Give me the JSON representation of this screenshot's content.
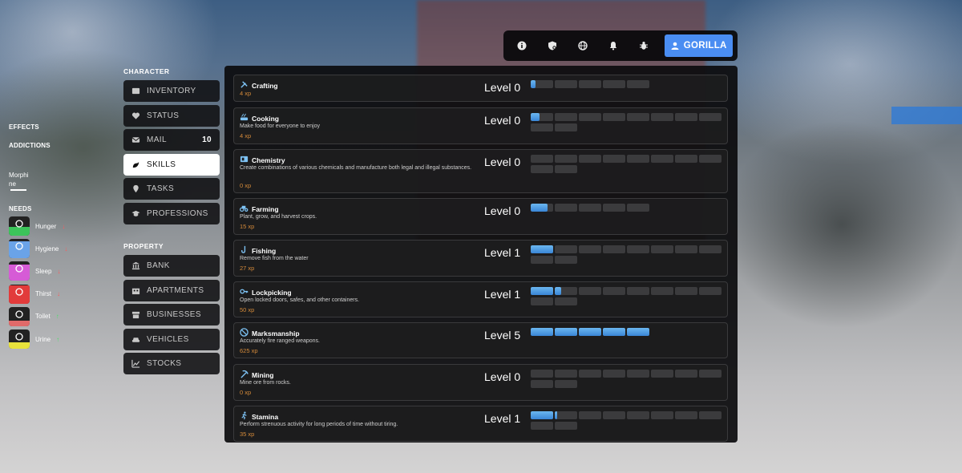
{
  "topbar": {
    "icons": [
      "info-icon",
      "shield-icon",
      "globe-icon",
      "bell-icon",
      "bug-icon"
    ],
    "user_name": "GORILLA",
    "accent": "#4a8df2"
  },
  "hud": {
    "effects_label": "EFFECTS",
    "addictions_label": "ADDICTIONS",
    "addiction_name": "Morphine",
    "needs_label": "NEEDS",
    "needs": [
      {
        "label": "Hunger",
        "trend": "down",
        "fill": 0.45,
        "color": "#3cc45a",
        "icon": "food-icon"
      },
      {
        "label": "Hygiene",
        "trend": "down",
        "fill": 0.9,
        "color": "#6aa3e8",
        "icon": "shower-icon"
      },
      {
        "label": "Sleep",
        "trend": "down",
        "fill": 0.85,
        "color": "#d65bd6",
        "icon": "bed-icon"
      },
      {
        "label": "Thirst",
        "trend": "down",
        "fill": 0.95,
        "color": "#e23b3b",
        "icon": "cup-icon"
      },
      {
        "label": "Toilet",
        "trend": "up",
        "fill": 0.3,
        "color": "#e06a6a",
        "icon": "toilet-icon"
      },
      {
        "label": "Urine",
        "trend": "up",
        "fill": 0.35,
        "color": "#e8e23c",
        "icon": "faucet-icon"
      }
    ]
  },
  "character": {
    "title": "CHARACTER",
    "items": [
      {
        "label": "INVENTORY",
        "icon": "inventory-icon"
      },
      {
        "label": "STATUS",
        "icon": "heartbeat-icon"
      },
      {
        "label": "MAIL",
        "icon": "mail-icon",
        "badge": "10"
      },
      {
        "label": "SKILLS",
        "icon": "skills-icon",
        "active": true
      },
      {
        "label": "TASKS",
        "icon": "tasks-icon"
      },
      {
        "label": "PROFESSIONS",
        "icon": "professions-icon"
      }
    ]
  },
  "property": {
    "title": "PROPERTY",
    "items": [
      {
        "label": "BANK",
        "icon": "bank-icon"
      },
      {
        "label": "APARTMENTS",
        "icon": "apartments-icon"
      },
      {
        "label": "BUSINESSES",
        "icon": "store-icon"
      },
      {
        "label": "VEHICLES",
        "icon": "car-icon"
      },
      {
        "label": "STOCKS",
        "icon": "chart-icon"
      }
    ]
  },
  "skills": [
    {
      "name": "Crafting",
      "desc": "",
      "xp": "4 xp",
      "level": "Level 0",
      "segments": 5,
      "progress": 0.04,
      "icon": "tools-icon"
    },
    {
      "name": "Cooking",
      "desc": "Make food for everyone to enjoy",
      "xp": "4 xp",
      "level": "Level 0",
      "segments": 10,
      "progress": 0.04,
      "icon": "cooking-icon"
    },
    {
      "name": "Chemistry",
      "desc": "Create combinations of various chemicals and manufacture both legal and illegal substances.",
      "xp": "0 xp",
      "level": "Level 0",
      "segments": 10,
      "progress": 0,
      "icon": "chemistry-icon"
    },
    {
      "name": "Farming",
      "desc": "Plant, grow, and harvest crops.",
      "xp": "15 xp",
      "level": "Level 0",
      "segments": 5,
      "progress": 0.15,
      "icon": "tractor-icon"
    },
    {
      "name": "Fishing",
      "desc": "Remove fish from the water",
      "xp": "27 xp",
      "level": "Level 1",
      "segments": 10,
      "progress": 0.1,
      "icon": "hook-icon"
    },
    {
      "name": "Lockpicking",
      "desc": "Open locked doors, safes, and other containers.",
      "xp": "50 xp",
      "level": "Level 1",
      "segments": 10,
      "progress": 0.13,
      "icon": "key-icon"
    },
    {
      "name": "Marksmanship",
      "desc": "Accurately fire ranged weapons.",
      "xp": "625 xp",
      "level": "Level 5",
      "segments": 5,
      "progress": 1.0,
      "icon": "target-icon"
    },
    {
      "name": "Mining",
      "desc": "Mine ore from rocks.",
      "xp": "0 xp",
      "level": "Level 0",
      "segments": 10,
      "progress": 0,
      "icon": "pickaxe-icon"
    },
    {
      "name": "Stamina",
      "desc": "Perform strenuous activity for long periods of time without tiring.",
      "xp": "35 xp",
      "level": "Level 1",
      "segments": 10,
      "progress": 0.11,
      "icon": "running-icon"
    }
  ]
}
